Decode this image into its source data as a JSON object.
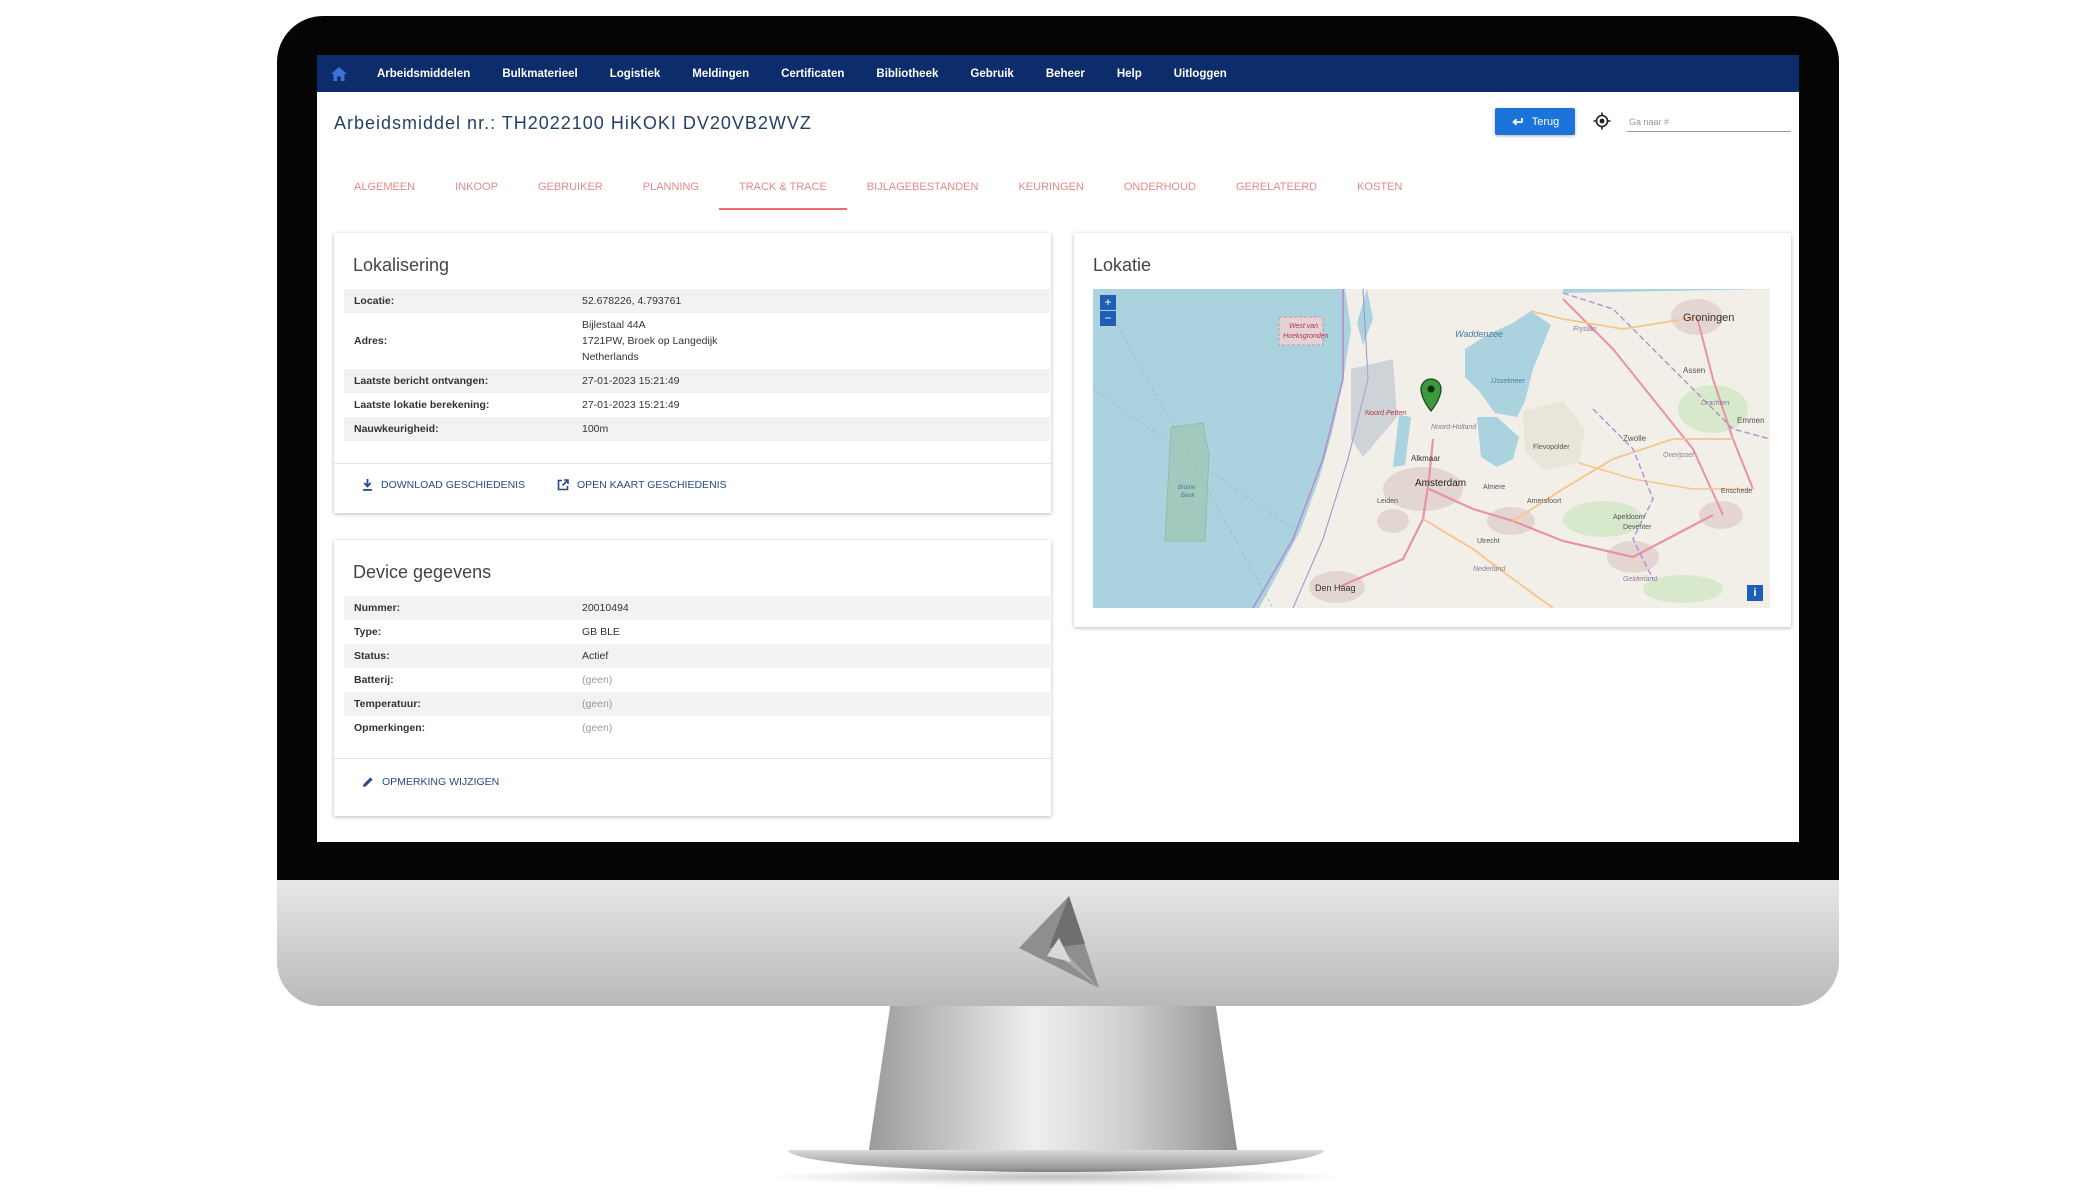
{
  "nav": {
    "home_icon": "home-icon",
    "items": [
      "Arbeidsmiddelen",
      "Bulkmaterieel",
      "Logistiek",
      "Meldingen",
      "Certificaten",
      "Bibliotheek",
      "Gebruik",
      "Beheer",
      "Help",
      "Uitloggen"
    ]
  },
  "header": {
    "title": "Arbeidsmiddel nr.: TH2022100 HiKOKI DV20VB2WVZ",
    "back_label": "Terug",
    "goto_placeholder": "Ga naar #"
  },
  "tabs": {
    "items": [
      "ALGEMEEN",
      "INKOOP",
      "GEBRUIKER",
      "PLANNING",
      "TRACK & TRACE",
      "BIJLAGEBESTANDEN",
      "KEURINGEN",
      "ONDERHOUD",
      "GERELATEERD",
      "KOSTEN"
    ],
    "active": "TRACK & TRACE"
  },
  "lokalisering": {
    "title": "Lokalisering",
    "rows": [
      {
        "label": "Locatie:",
        "value": "52.678226, 4.793761"
      },
      {
        "label": "Adres:",
        "lines": [
          "Bijlestaal 44A",
          "1721PW, Broek op Langedijk",
          "Netherlands"
        ]
      },
      {
        "label": "Laatste bericht ontvangen:",
        "value": "27-01-2023 15:21:49"
      },
      {
        "label": "Laatste lokatie berekening:",
        "value": "27-01-2023 15:21:49"
      },
      {
        "label": "Nauwkeurigheid:",
        "value": "100m"
      }
    ],
    "actions": {
      "download": "DOWNLOAD GESCHIEDENIS",
      "open_map": "OPEN KAART GESCHIEDENIS"
    }
  },
  "device": {
    "title": "Device gegevens",
    "rows": [
      {
        "label": "Nummer:",
        "value": "20010494"
      },
      {
        "label": "Type:",
        "value": "GB BLE"
      },
      {
        "label": "Status:",
        "value": "Actief"
      },
      {
        "label": "Batterij:",
        "value": "(geen)"
      },
      {
        "label": "Temperatuur:",
        "value": "(geen)"
      },
      {
        "label": "Opmerkingen:",
        "value": "(geen)"
      }
    ],
    "action": "OPMERKING WIJZIGEN"
  },
  "lokatie": {
    "title": "Lokatie",
    "map": {
      "zoom_in": "+",
      "zoom_out": "−",
      "info": "i",
      "labels": {
        "groningen": "Groningen",
        "waddenzee": "Waddenzee",
        "assen": "Assen",
        "emmen": "Emmen",
        "drachten": "Drachten",
        "friesland": "Fryslân",
        "west_van": "West van",
        "hoeksgronden": "Hoeksgronden",
        "noord_holland": "Noord-Holland",
        "noord_petten": "Noord Petten",
        "alkmaar": "Alkmaar",
        "bruine": "Bruine",
        "bank": "Bank",
        "flevopolder": "Flevopolder",
        "zwolle": "Zwolle",
        "amsterdam": "Amsterdam",
        "almere": "Almere",
        "overijssel": "Overijssel",
        "enschede": "Enschede",
        "apeldoorn": "Apeldoorn",
        "deventer": "Deventer",
        "leiden": "Leiden",
        "utrecht": "Utrecht",
        "amersfoort": "Amersfoort",
        "den_haag": "Den Haag",
        "gelderland": "Gelderland",
        "nederland": "Nederland",
        "ijsselmeer": "IJsselmeer"
      }
    }
  },
  "colors": {
    "nav_bg": "#0d2c6c",
    "accent_blue": "#1b74d9",
    "tab_text": "#e58a8a",
    "tab_active": "#ef6d6d",
    "marker": "#3c9a3c"
  }
}
